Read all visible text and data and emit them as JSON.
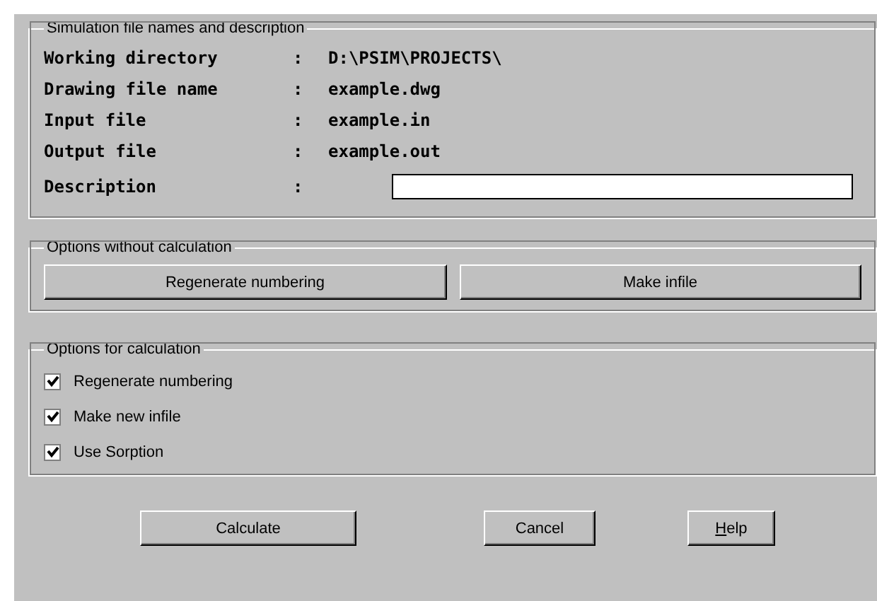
{
  "file_group": {
    "title": "Simulation file names and description",
    "fields": [
      {
        "label": "Working directory",
        "colon": ":",
        "value": "D:\\PSIM\\PROJECTS\\"
      },
      {
        "label": "Drawing file name",
        "colon": ":",
        "value": "example.dwg"
      },
      {
        "label": "Input file",
        "colon": ":",
        "value": "example.in"
      },
      {
        "label": "Output file",
        "colon": ":",
        "value": "example.out"
      }
    ],
    "description": {
      "label": "Description",
      "colon": ":"
    }
  },
  "options_group": {
    "title": "Options without calculation",
    "buttons": [
      "Regenerate numbering",
      "Make infile"
    ]
  },
  "calc_group": {
    "title": "Options for calculation",
    "checkboxes": [
      {
        "label": "Regenerate numbering",
        "checked": true
      },
      {
        "label": "Make new infile",
        "checked": true
      },
      {
        "label": "Use Sorption",
        "checked": true
      }
    ]
  },
  "buttons": [
    "Calculate",
    "Cancel",
    "Help"
  ]
}
